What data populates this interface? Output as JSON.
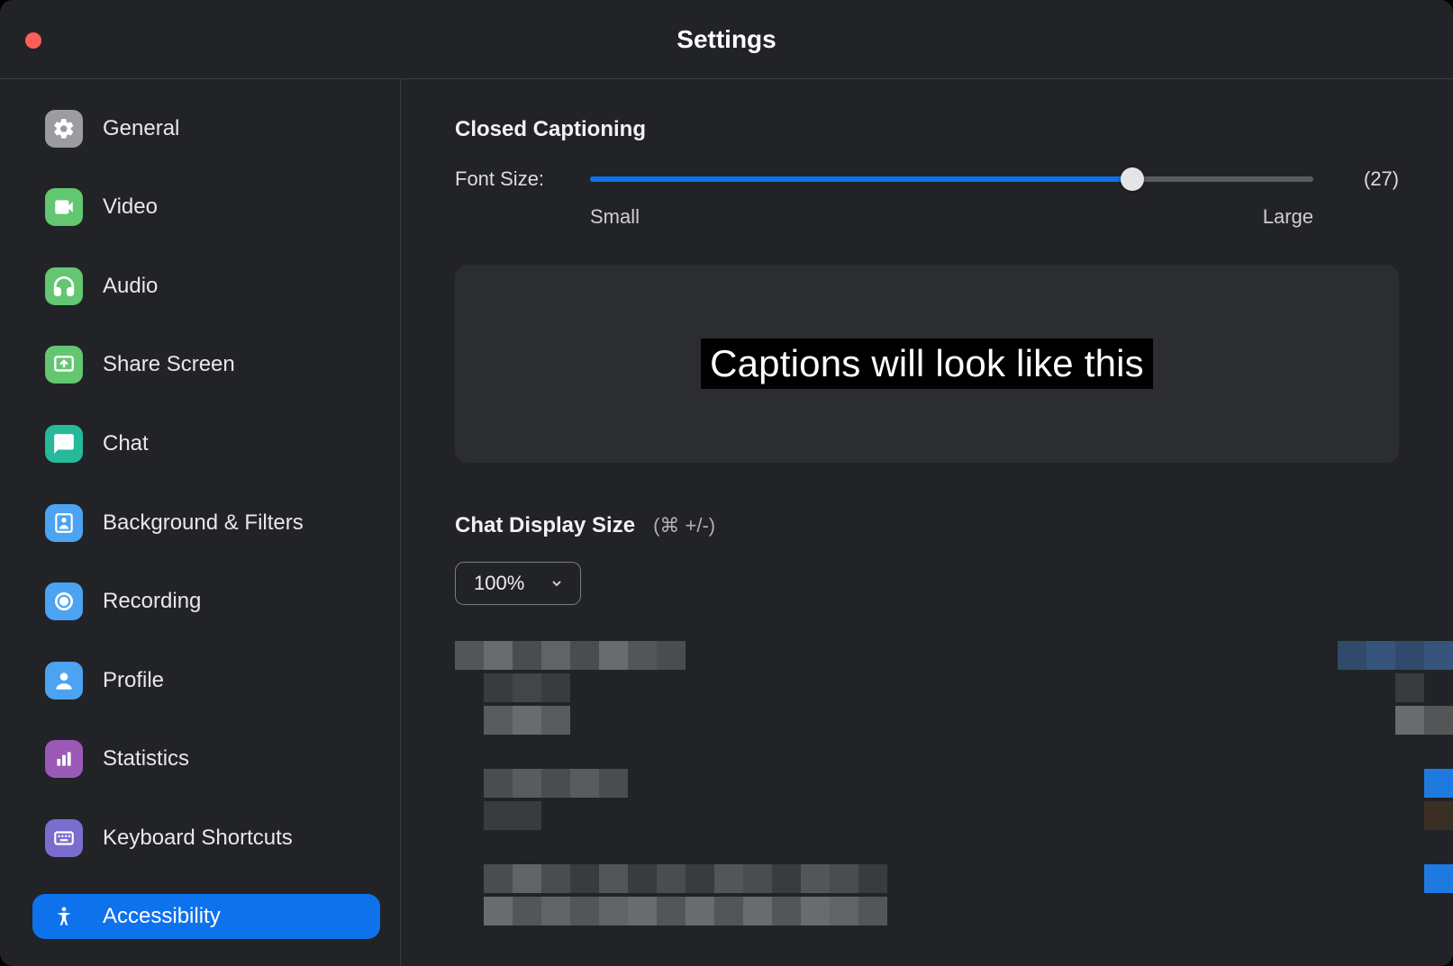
{
  "window_title": "Settings",
  "sidebar": {
    "items": [
      {
        "label": "General"
      },
      {
        "label": "Video"
      },
      {
        "label": "Audio"
      },
      {
        "label": "Share Screen"
      },
      {
        "label": "Chat"
      },
      {
        "label": "Background & Filters"
      },
      {
        "label": "Recording"
      },
      {
        "label": "Profile"
      },
      {
        "label": "Statistics"
      },
      {
        "label": "Keyboard Shortcuts"
      },
      {
        "label": "Accessibility"
      }
    ],
    "selected_index": 10
  },
  "closed_captioning": {
    "title": "Closed Captioning",
    "font_size_label": "Font Size:",
    "font_size_value": "(27)",
    "tick_small": "Small",
    "tick_large": "Large",
    "preview_text": "Captions will look like this"
  },
  "chat_display": {
    "title": "Chat Display Size",
    "hint": "(⌘ +/-)",
    "selected": "100%"
  }
}
